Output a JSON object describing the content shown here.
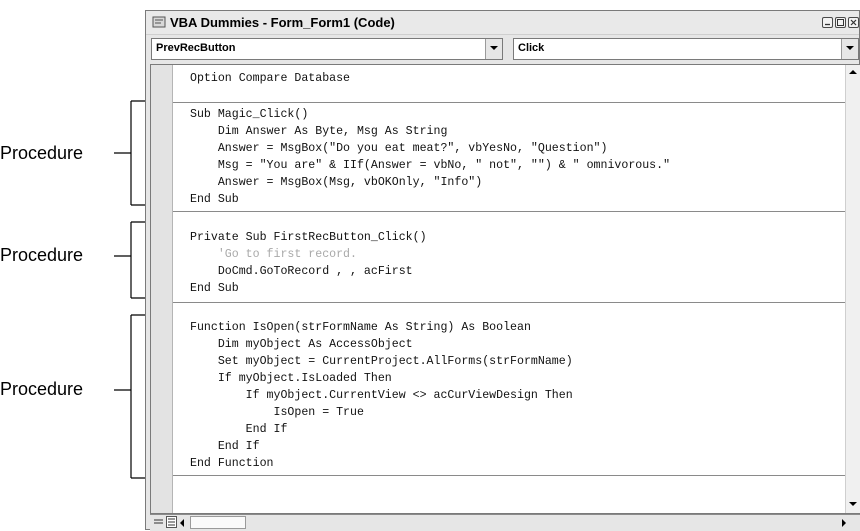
{
  "window": {
    "title": "VBA Dummies - Form_Form1 (Code)",
    "object_dropdown": "PrevRecButton",
    "procedure_dropdown": "Click"
  },
  "code_lines": [
    "Option Compare Database",
    "Sub Magic_Click()",
    "    Dim Answer As Byte, Msg As String",
    "    Answer = MsgBox(\"Do you eat meat?\", vbYesNo, \"Question\")",
    "    Msg = \"You are\" & IIf(Answer = vbNo, \" not\", \"\") & \" omnivorous.\"",
    "    Answer = MsgBox(Msg, vbOKOnly, \"Info\")",
    "End Sub",
    "Private Sub FirstRecButton_Click()",
    "    'Go to first record.",
    "    DoCmd.GoToRecord , , acFirst",
    "End Sub",
    "Function IsOpen(strFormName As String) As Boolean",
    "    Dim myObject As AccessObject",
    "    Set myObject = CurrentProject.AllForms(strFormName)",
    "    If myObject.IsLoaded Then",
    "        If myObject.CurrentView <> acCurViewDesign Then",
    "            IsOpen = True",
    "        End If",
    "    End If",
    "End Function"
  ],
  "callouts": [
    "Procedure",
    "Procedure",
    "Procedure"
  ],
  "icons": {
    "window_icon": "code-window-icon",
    "minimize": "minimize-icon",
    "maximize": "maximize-icon",
    "close": "close-icon"
  }
}
